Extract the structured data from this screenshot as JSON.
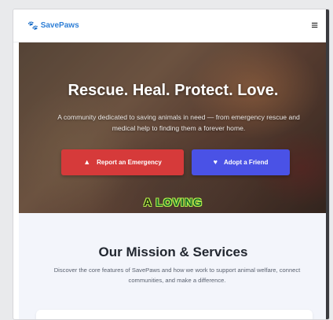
{
  "navbar": {
    "brand": "SavePaws",
    "brand_icon": "paw-icon",
    "menu_icon": "hamburger-menu-icon",
    "menu_glyph": "≡"
  },
  "hero": {
    "title": "Rescue. Heal. Protect. Love.",
    "subtitle": "A community dedicated to saving animals in need — from emergency rescue and medical help to finding them a forever home.",
    "buttons": {
      "emergency_label": "Report an Emergency",
      "emergency_icon": "warning-icon",
      "adopt_label": "Adopt a Friend",
      "adopt_icon": "heart-icon"
    },
    "tagline_a": "A",
    "tagline_word": "LOVING"
  },
  "mission": {
    "title": "Our Mission & Services",
    "description": "Discover the core features of SavePaws and how we work to support animal welfare, connect communities, and make a difference."
  },
  "colors": {
    "brand": "#2f7fd6",
    "emergency": "#d63a3a",
    "adopt": "#4a52e6",
    "section_bg": "#f3f5fb"
  }
}
